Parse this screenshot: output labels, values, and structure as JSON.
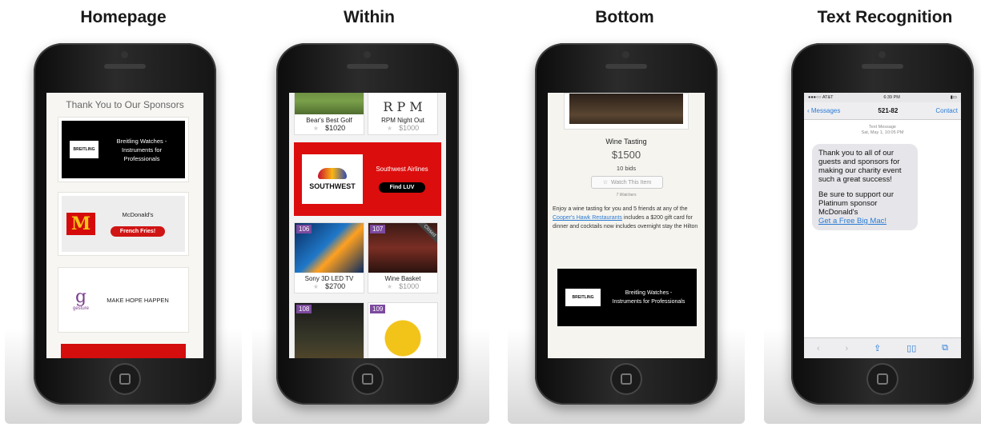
{
  "captions": [
    "Homepage",
    "Within",
    "Bottom",
    "Text Recognition"
  ],
  "homepage": {
    "title": "Thank You to Our Sponsors",
    "breitling": {
      "logo_text": "BREITLING",
      "line1": "Breitling Watches -",
      "line2": "Instruments for",
      "line3": "Professionals"
    },
    "mcdonalds": {
      "logo_glyph": "M",
      "name": "McDonald's",
      "button": "French Fries!"
    },
    "gesture": {
      "logo_glyph": "g",
      "logo_text": "gesture",
      "tagline": "MAKE HOPE HAPPEN"
    }
  },
  "within": {
    "top_tiles": [
      {
        "name": "Bear's Best Golf",
        "price": "$1020",
        "price_style": "dark"
      },
      {
        "name": "RPM Night Out",
        "price": "$1000",
        "price_style": "grey"
      }
    ],
    "ad": {
      "logo_word": "SOUTHWEST",
      "title": "Southwest Airlines",
      "button": "Find LUV"
    },
    "mid_tiles": [
      {
        "badge": "106",
        "name": "Sony 3D LED TV",
        "price": "$2700",
        "price_style": "dark"
      },
      {
        "badge": "107",
        "name": "Wine Basket",
        "price": "$1000",
        "price_style": "grey",
        "ribbon": "Closed"
      }
    ],
    "bottom_tiles": [
      {
        "badge": "108"
      },
      {
        "badge": "109"
      }
    ],
    "star_glyph": "★"
  },
  "bottom": {
    "item_title": "Wine Tasting",
    "price": "$1500",
    "bids": "10 bids",
    "watch_button": "Watch This Item",
    "watchers": "7 Watchers",
    "description_before": "Enjoy a wine tasting for you and 5 friends at any of the ",
    "description_link": "Cooper's Hawk Restaurants",
    "description_after": " includes a $200 gift card for dinner and cocktails now includes overnight stay the Hilton",
    "breitling": {
      "logo_text": "BREITLING",
      "line1": "Breitling Watches -",
      "line2": "Instruments for Professionals"
    }
  },
  "text_recognition": {
    "status": {
      "carrier": "●●●○○ AT&T",
      "time": "6:39 PM",
      "battery": "▮▭"
    },
    "nav": {
      "back": "Messages",
      "number": "521-82",
      "contact": "Contact"
    },
    "meta_line1": "Text Message",
    "meta_line2": "Sat, May 1, 10:05 PM",
    "message_part1": "Thank you to all of our guests and sponsors for making our charity event such a great success!",
    "message_part2": "Be sure to support our Platinum sponsor McDonald's",
    "message_link": "Get a Free Big Mac!",
    "toolbar_icons": [
      "‹",
      "›",
      "⇪",
      "▯▯",
      "⧉"
    ]
  }
}
